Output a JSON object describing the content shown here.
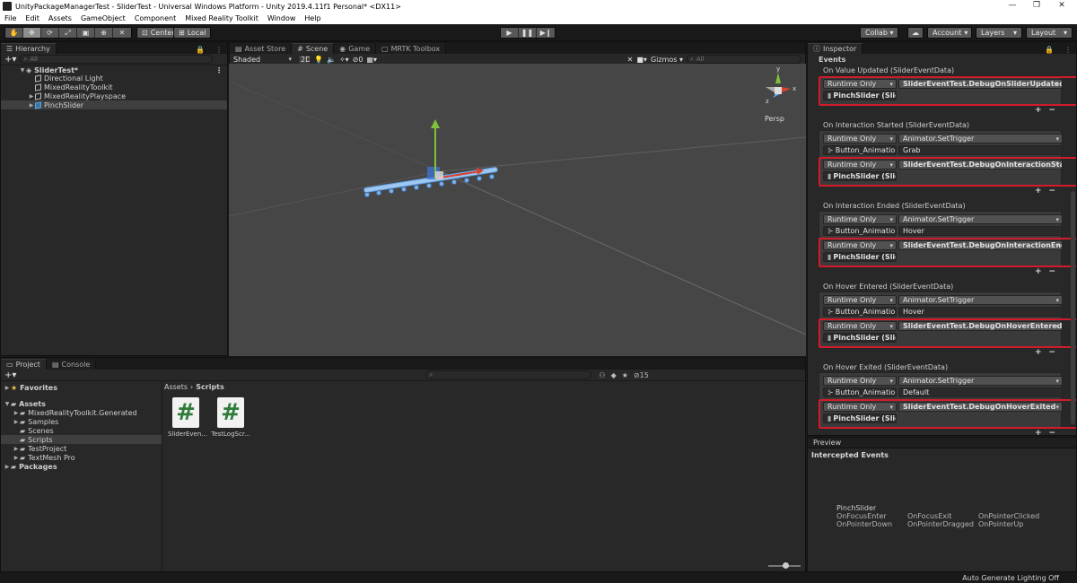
{
  "window": {
    "title": "UnityPackageManagerTest - SliderTest - Universal Windows Platform - Unity 2019.4.11f1 Personal* <DX11>",
    "minimize": "—",
    "maximize": "❐",
    "close": "✕"
  },
  "menu": [
    "File",
    "Edit",
    "Assets",
    "GameObject",
    "Component",
    "Mixed Reality Toolkit",
    "Window",
    "Help"
  ],
  "toolbar": {
    "center_label": "Center",
    "local_label": "Local",
    "collab_label": "Collab ▾",
    "account_label": "Account",
    "layers_label": "Layers",
    "layout_label": "Layout"
  },
  "hierarchy": {
    "tab": "Hierarchy",
    "search_placeholder": "All",
    "scene_name": "SliderTest*",
    "items": [
      {
        "label": "Directional Light",
        "depth": 1,
        "expandable": false,
        "selected": false
      },
      {
        "label": "MixedRealityToolkit",
        "depth": 1,
        "expandable": false,
        "selected": false
      },
      {
        "label": "MixedRealityPlayspace",
        "depth": 1,
        "expandable": true,
        "selected": false
      },
      {
        "label": "PinchSlider",
        "depth": 1,
        "expandable": true,
        "selected": true
      }
    ]
  },
  "center_tabs": [
    "Asset Store",
    "Scene",
    "Game",
    "MRTK Toolbox"
  ],
  "scene": {
    "shading": "Shaded",
    "mode_2d": "2D",
    "hidden_count": "0",
    "gizmos_label": "Gizmos",
    "search_placeholder": "All",
    "persp_label": "Persp",
    "axis_x": "x",
    "axis_y": "y",
    "axis_z": "z"
  },
  "project": {
    "tabs": [
      "Project",
      "Console"
    ],
    "favorites_label": "Favorites",
    "assets_label": "Assets",
    "folders": [
      "MixedRealityToolkit.Generated",
      "Samples",
      "Scenes",
      "Scripts",
      "TestProject",
      "TextMesh Pro"
    ],
    "selected_folder": "Scripts",
    "packages_label": "Packages",
    "breadcrumb_root": "Assets",
    "breadcrumb_leaf": "Scripts",
    "hidden_count": "15",
    "files": [
      {
        "name": "SliderEven...",
        "glyph": "#"
      },
      {
        "name": "TestLogScr...",
        "glyph": "#"
      }
    ]
  },
  "inspector": {
    "tab": "Inspector",
    "events_header": "Events",
    "runtime_only": "Runtime Only",
    "events": [
      {
        "label": "On Value Updated (SliderEventData)",
        "entries": [
          {
            "mode": "Runtime Only",
            "function": "SliderEventTest.DebugOnSliderUpdated",
            "target": "PinchSlider (Slid",
            "arg": "",
            "highlight": true
          }
        ]
      },
      {
        "label": "On Interaction Started (SliderEventData)",
        "entries": [
          {
            "mode": "Runtime Only",
            "function": "Animator.SetTrigger",
            "target": "Button_Animatio",
            "arg": "Grab",
            "highlight": false
          },
          {
            "mode": "Runtime Only",
            "function": "SliderEventTest.DebugOnInteractionStarted",
            "target": "PinchSlider (Slid",
            "arg": "",
            "highlight": true
          }
        ]
      },
      {
        "label": "On Interaction Ended (SliderEventData)",
        "entries": [
          {
            "mode": "Runtime Only",
            "function": "Animator.SetTrigger",
            "target": "Button_Animatio",
            "arg": "Hover",
            "highlight": false
          },
          {
            "mode": "Runtime Only",
            "function": "SliderEventTest.DebugOnInteractionEnded",
            "target": "PinchSlider (Slid",
            "arg": "",
            "highlight": true
          }
        ]
      },
      {
        "label": "On Hover Entered (SliderEventData)",
        "entries": [
          {
            "mode": "Runtime Only",
            "function": "Animator.SetTrigger",
            "target": "Button_Animatio",
            "arg": "Hover",
            "highlight": false
          },
          {
            "mode": "Runtime Only",
            "function": "SliderEventTest.DebugOnHoverEntered",
            "target": "PinchSlider (Slid",
            "arg": "",
            "highlight": true
          }
        ]
      },
      {
        "label": "On Hover Exited (SliderEventData)",
        "entries": [
          {
            "mode": "Runtime Only",
            "function": "Animator.SetTrigger",
            "target": "Button_Animatio",
            "arg": "Default",
            "highlight": false
          },
          {
            "mode": "Runtime Only",
            "function": "SliderEventTest.DebugOnHoverExited",
            "target": "PinchSlider (Slid",
            "arg": "",
            "highlight": true
          }
        ]
      }
    ],
    "plus": "+",
    "minus": "−"
  },
  "preview": {
    "tab": "Preview",
    "intercepted_header": "Intercepted Events",
    "object_name": "PinchSlider",
    "events": [
      "OnFocusEnter",
      "OnFocusExit",
      "OnPointerClicked",
      "OnPointerDown",
      "OnPointerDragged",
      "OnPointerUp"
    ]
  },
  "status": {
    "lighting": "Auto Generate Lighting Off"
  },
  "colors": {
    "highlight_red": "#d21b2a",
    "slider_blue": "#5ea2e6",
    "gizmo_green": "#7ec23a",
    "gizmo_red": "#d9402e"
  }
}
